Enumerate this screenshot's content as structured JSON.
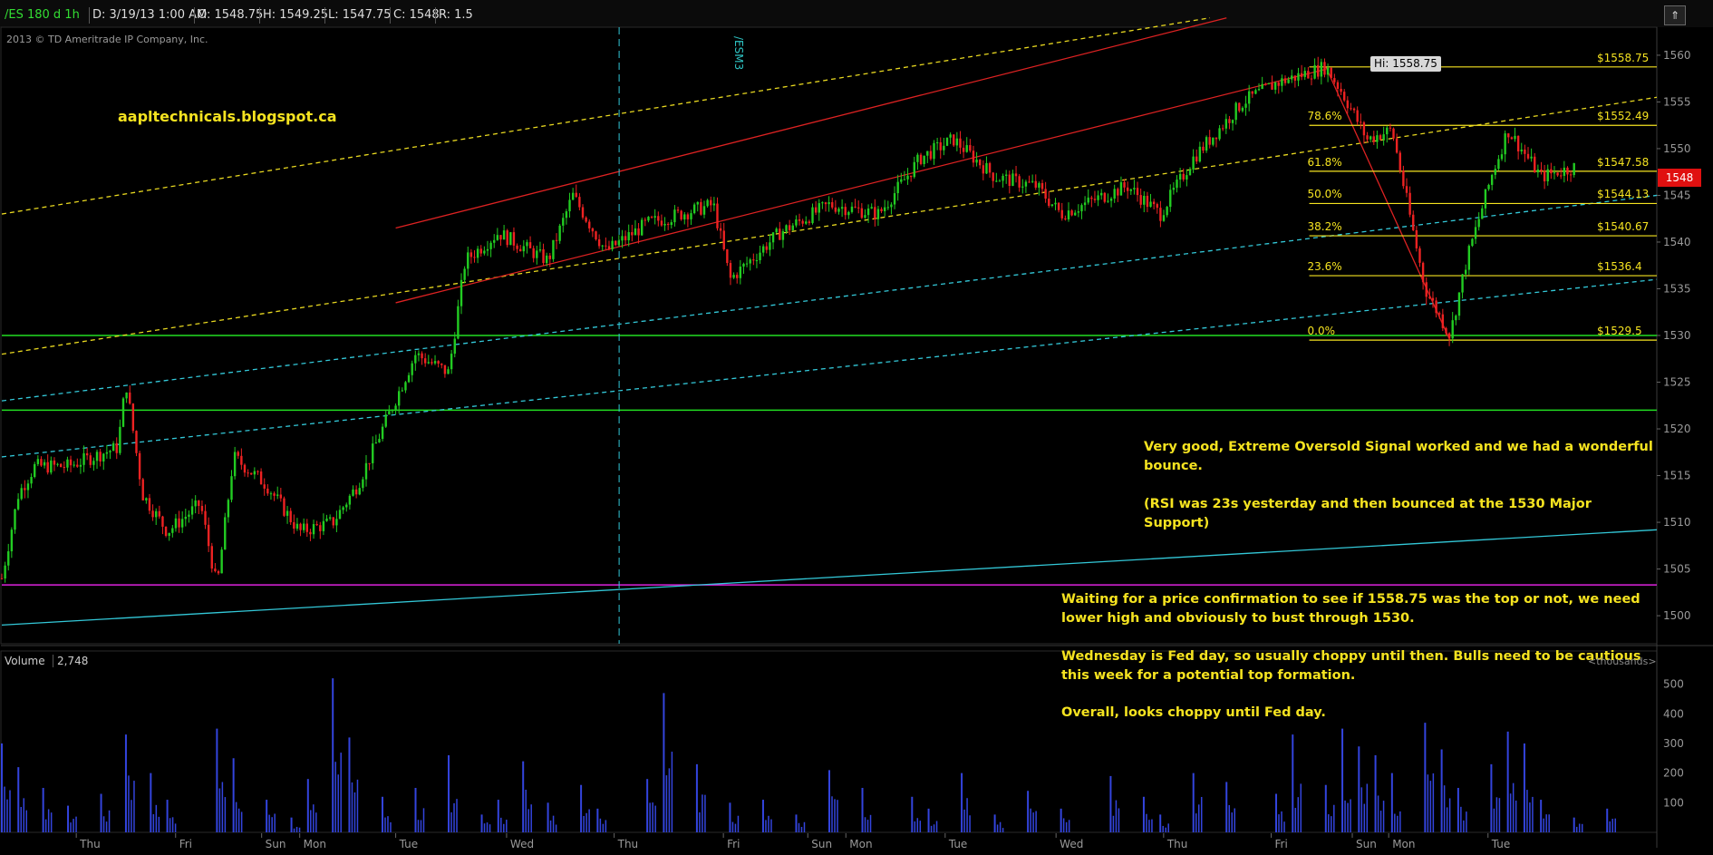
{
  "header": {
    "symbol": "/ES 180 d 1h",
    "date": "D: 3/19/13 1:00 AM",
    "open": "O: 1548.75",
    "high": "H: 1549.25",
    "low": "L: 1547.75",
    "close": "C: 1548",
    "range": "R: 1.5"
  },
  "copyright": "2013 © TD Ameritrade IP Company, Inc.",
  "watermark": "aapltechnicals.blogspot.ca",
  "rollover_label": "/ESM3",
  "hi_label": "Hi: 1558.75",
  "price_tag": "1548",
  "volume": {
    "label": "Volume",
    "value": "2,748",
    "units": "<thousands>"
  },
  "notes": {
    "n1": [
      "Very good, Extreme Oversold Signal worked and we had a wonderful",
      "bounce."
    ],
    "n2": [
      "(RSI was 23s yesterday and then bounced at the 1530 Major",
      "Support)"
    ],
    "n3": [
      "Waiting for a price confirmation to see if 1558.75 was the top or not, we need",
      "lower high and obviously to bust through 1530."
    ],
    "n4": [
      " Wednesday is Fed day, so usually choppy until then. Bulls need to be cautious",
      "this week for a potential top formation."
    ],
    "n5": "Overall, looks choppy until Fed day."
  },
  "chart_data": {
    "type": "candlestick",
    "title": "/ES 180 d 1h",
    "price_axis": {
      "ylim": [
        1497,
        1563
      ],
      "ticks": [
        1500,
        1505,
        1510,
        1515,
        1520,
        1525,
        1530,
        1535,
        1540,
        1545,
        1550,
        1555,
        1560
      ]
    },
    "volume_axis": {
      "ylim": [
        0,
        560
      ],
      "ticks": [
        100,
        200,
        300,
        400,
        500
      ],
      "units": "<thousands>"
    },
    "x_labels": [
      "Thu",
      "Fri",
      "Sun",
      "Mon",
      "Tue",
      "Wed",
      "Thu",
      "Fri",
      "Sun",
      "Mon",
      "Tue",
      "Wed",
      "Thu",
      "Fri",
      "Sun",
      "Mon",
      "Tue"
    ],
    "price_path": [
      [
        0,
        1504
      ],
      [
        0.01,
        1513
      ],
      [
        0.02,
        1516
      ],
      [
        0.04,
        1516
      ],
      [
        0.07,
        1518
      ],
      [
        0.075,
        1525
      ],
      [
        0.085,
        1513
      ],
      [
        0.1,
        1509
      ],
      [
        0.12,
        1512
      ],
      [
        0.13,
        1503
      ],
      [
        0.14,
        1517
      ],
      [
        0.16,
        1514
      ],
      [
        0.18,
        1509
      ],
      [
        0.2,
        1510
      ],
      [
        0.215,
        1514
      ],
      [
        0.235,
        1522
      ],
      [
        0.25,
        1528
      ],
      [
        0.27,
        1526
      ],
      [
        0.28,
        1538
      ],
      [
        0.3,
        1541
      ],
      [
        0.33,
        1538
      ],
      [
        0.345,
        1545
      ],
      [
        0.365,
        1539
      ],
      [
        0.39,
        1542
      ],
      [
        0.43,
        1544
      ],
      [
        0.44,
        1536
      ],
      [
        0.47,
        1541
      ],
      [
        0.5,
        1544
      ],
      [
        0.53,
        1543
      ],
      [
        0.555,
        1549
      ],
      [
        0.575,
        1551
      ],
      [
        0.6,
        1547
      ],
      [
        0.625,
        1546
      ],
      [
        0.64,
        1543
      ],
      [
        0.68,
        1546
      ],
      [
        0.7,
        1543
      ],
      [
        0.72,
        1549
      ],
      [
        0.75,
        1555
      ],
      [
        0.77,
        1557
      ],
      [
        0.8,
        1558.75
      ],
      [
        0.81,
        1556
      ],
      [
        0.825,
        1551
      ],
      [
        0.84,
        1552
      ],
      [
        0.86,
        1535
      ],
      [
        0.875,
        1530
      ],
      [
        0.885,
        1538
      ],
      [
        0.9,
        1547
      ],
      [
        0.91,
        1552
      ],
      [
        0.93,
        1547
      ],
      [
        0.95,
        1548
      ]
    ],
    "volume_bars": [
      [
        0.0,
        300
      ],
      [
        0.01,
        220
      ],
      [
        0.025,
        150
      ],
      [
        0.04,
        90
      ],
      [
        0.06,
        130
      ],
      [
        0.075,
        330
      ],
      [
        0.09,
        200
      ],
      [
        0.1,
        110
      ],
      [
        0.13,
        350
      ],
      [
        0.14,
        250
      ],
      [
        0.16,
        110
      ],
      [
        0.175,
        50
      ],
      [
        0.185,
        180
      ],
      [
        0.2,
        520
      ],
      [
        0.21,
        320
      ],
      [
        0.23,
        120
      ],
      [
        0.25,
        150
      ],
      [
        0.27,
        260
      ],
      [
        0.29,
        60
      ],
      [
        0.3,
        110
      ],
      [
        0.315,
        240
      ],
      [
        0.33,
        100
      ],
      [
        0.35,
        160
      ],
      [
        0.36,
        80
      ],
      [
        0.39,
        180
      ],
      [
        0.4,
        470
      ],
      [
        0.42,
        230
      ],
      [
        0.44,
        100
      ],
      [
        0.46,
        110
      ],
      [
        0.48,
        60
      ],
      [
        0.5,
        210
      ],
      [
        0.52,
        150
      ],
      [
        0.55,
        120
      ],
      [
        0.56,
        80
      ],
      [
        0.58,
        200
      ],
      [
        0.6,
        60
      ],
      [
        0.62,
        140
      ],
      [
        0.64,
        80
      ],
      [
        0.67,
        190
      ],
      [
        0.69,
        120
      ],
      [
        0.7,
        60
      ],
      [
        0.72,
        200
      ],
      [
        0.74,
        170
      ],
      [
        0.77,
        130
      ],
      [
        0.78,
        330
      ],
      [
        0.8,
        160
      ],
      [
        0.81,
        350
      ],
      [
        0.82,
        290
      ],
      [
        0.83,
        260
      ],
      [
        0.84,
        200
      ],
      [
        0.86,
        370
      ],
      [
        0.87,
        280
      ],
      [
        0.88,
        150
      ],
      [
        0.9,
        230
      ],
      [
        0.91,
        340
      ],
      [
        0.92,
        300
      ],
      [
        0.93,
        110
      ],
      [
        0.95,
        50
      ],
      [
        0.97,
        80
      ]
    ],
    "horizontal_levels": [
      {
        "value": 1530,
        "color": "#22dd22"
      },
      {
        "value": 1522,
        "color": "#22dd22"
      },
      {
        "value": 1503.3,
        "color": "#dd22dd"
      }
    ],
    "fibonacci": {
      "levels": [
        {
          "pct": "78.6%",
          "value": "$1552.49",
          "price": 1552.49
        },
        {
          "pct": "61.8%",
          "value": "$1547.58",
          "price": 1547.58
        },
        {
          "pct": "50.0%",
          "value": "$1544.13",
          "price": 1544.13
        },
        {
          "pct": "38.2%",
          "value": "$1540.67",
          "price": 1540.67
        },
        {
          "pct": "23.6%",
          "value": "$1536.4",
          "price": 1536.4
        },
        {
          "pct": "0.0%",
          "value": "$1529.5",
          "price": 1529.5
        }
      ],
      "top": {
        "value": "$1558.75",
        "price": 1558.75
      }
    },
    "colors": {
      "up": "#22cc22",
      "down": "#ee2222",
      "volume": "#3344dd",
      "fib": "#f5e320",
      "channel_red": "#dd2222",
      "channel_yellow": "#e8d820",
      "channel_cyan": "#33c8d8"
    }
  }
}
